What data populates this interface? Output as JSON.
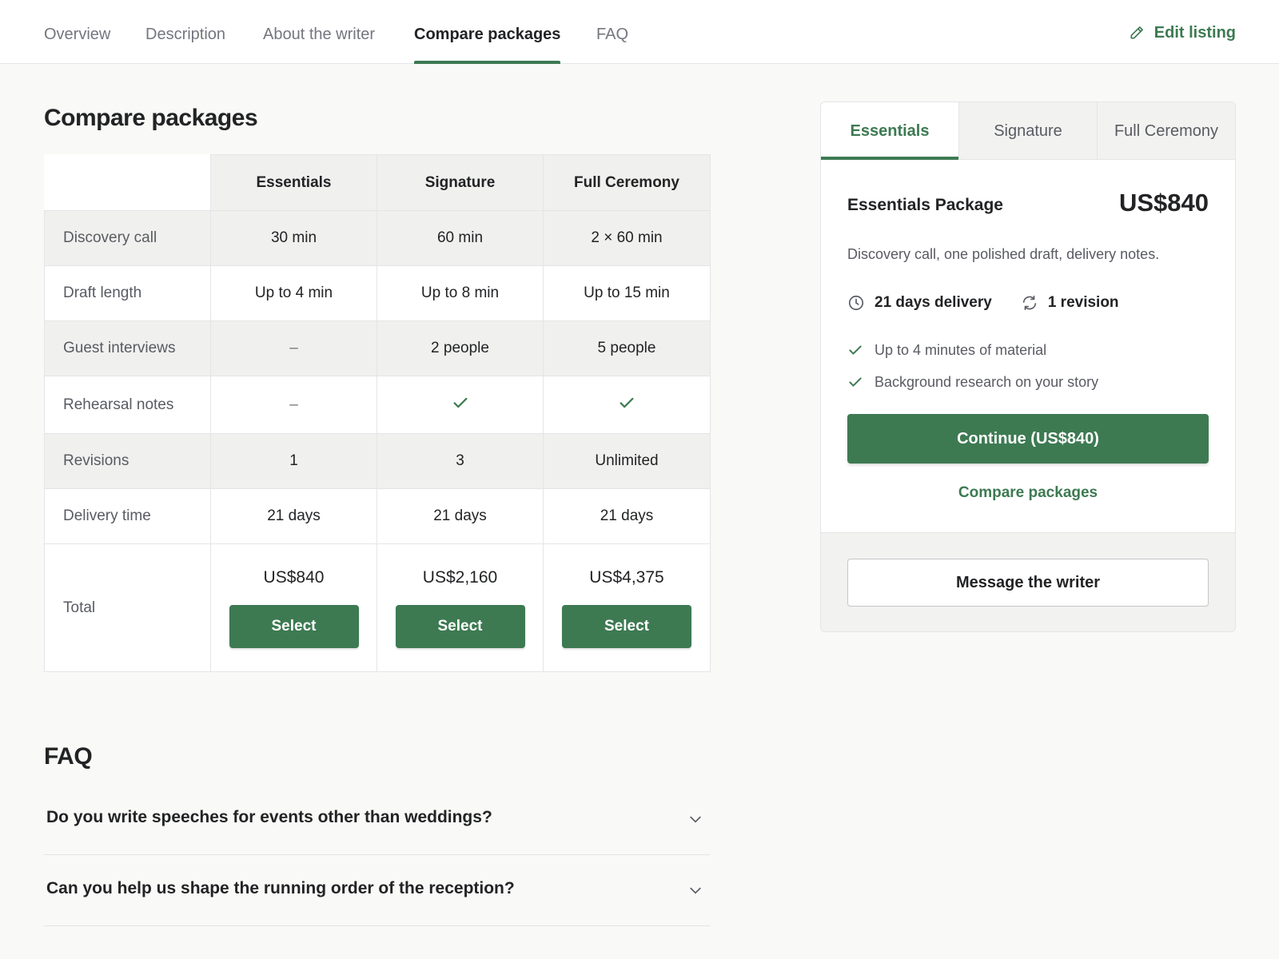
{
  "nav": {
    "tabs": [
      {
        "label": "Overview"
      },
      {
        "label": "Description"
      },
      {
        "label": "About the writer"
      },
      {
        "label": "Compare packages",
        "active": true
      },
      {
        "label": "FAQ"
      }
    ],
    "edit_label": "Edit listing"
  },
  "compare": {
    "title": "Compare packages",
    "columns": [
      "Essentials",
      "Signature",
      "Full Ceremony"
    ],
    "rows": [
      {
        "label": "Discovery call",
        "values": [
          "30 min",
          "60 min",
          "2 × 60 min"
        ]
      },
      {
        "label": "Draft length",
        "values": [
          "Up to 4 min",
          "Up to 8 min",
          "Up to 15 min"
        ]
      },
      {
        "label": "Guest interviews",
        "values": [
          "–",
          "2 people",
          "5 people"
        ]
      },
      {
        "label": "Rehearsal notes",
        "values": [
          "–",
          "check",
          "check"
        ]
      },
      {
        "label": "Revisions",
        "values": [
          "1",
          "3",
          "Unlimited"
        ]
      },
      {
        "label": "Delivery time",
        "values": [
          "21 days",
          "21 days",
          "21 days"
        ]
      }
    ],
    "total": {
      "label": "Total",
      "prices": [
        "US$840",
        "US$2,160",
        "US$4,375"
      ],
      "select_label": "Select"
    }
  },
  "package_card": {
    "tabs": [
      "Essentials",
      "Signature",
      "Full Ceremony"
    ],
    "active_tab": "Essentials",
    "name": "Essentials Package",
    "price": "US$840",
    "description": "Discovery call, one polished draft, delivery notes.",
    "delivery": "21 days delivery",
    "revisions": "1 revision",
    "features": [
      "Up to 4 minutes of material",
      "Background research on your story"
    ],
    "continue_label": "Continue (US$840)",
    "compare_link": "Compare packages",
    "message_label": "Message the writer"
  },
  "faq": {
    "title": "FAQ",
    "items": [
      {
        "question": "Do you write speeches for events other than weddings?"
      },
      {
        "question": "Can you help us shape the running order of the reception?"
      }
    ]
  },
  "colors": {
    "accent": "#3d7a52",
    "text": "#222325",
    "muted": "#74767e",
    "border": "#e4e5e7"
  }
}
